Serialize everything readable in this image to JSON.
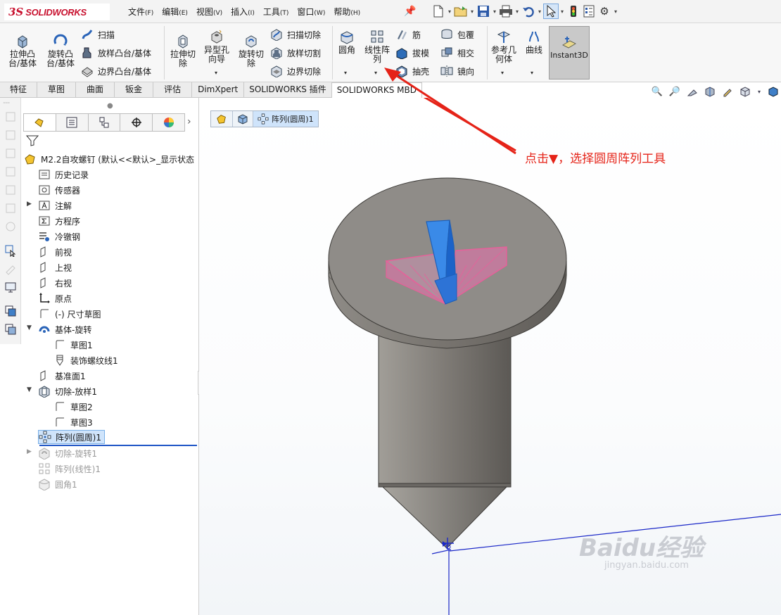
{
  "app": {
    "logo_ds": "3S",
    "logo_text": "SOLIDWORKS"
  },
  "menu": [
    {
      "label": "文件",
      "key": "(F)"
    },
    {
      "label": "编辑",
      "key": "(E)"
    },
    {
      "label": "视图",
      "key": "(V)"
    },
    {
      "label": "插入",
      "key": "(I)"
    },
    {
      "label": "工具",
      "key": "(T)"
    },
    {
      "label": "窗口",
      "key": "(W)"
    },
    {
      "label": "帮助",
      "key": "(H)"
    }
  ],
  "ribbon": {
    "extrude_boss": "拉伸凸\n台/基体",
    "revolve_boss": "旋转凸\n台/基体",
    "sweep": "扫描",
    "loft_boss": "放样凸台/基体",
    "boundary_boss": "边界凸台/基体",
    "extrude_cut": "拉伸切\n除",
    "hole_wizard": "异型孔\n向导",
    "revolve_cut": "旋转切\n除",
    "sweep_cut": "扫描切除",
    "loft_cut": "放样切割",
    "boundary_cut": "边界切除",
    "fillet": "圆角",
    "linear_pattern": "线性阵\n列",
    "rib": "筋",
    "draft": "拔模",
    "shell": "抽壳",
    "wrap": "包覆",
    "intersect": "相交",
    "mirror": "镜向",
    "ref_geometry": "参考几\n何体",
    "curves": "曲线",
    "instant3d": "Instant3D"
  },
  "tabs": [
    "特征",
    "草图",
    "曲面",
    "钣金",
    "评估",
    "DimXpert",
    "SOLIDWORKS 插件",
    "SOLIDWORKS MBD"
  ],
  "tree": {
    "root": "M2.2自攻螺钉  (默认<<默认>_显示状态",
    "history": "历史记录",
    "sensors": "传感器",
    "annotations": "注解",
    "equations": "方程序",
    "material": "冷镦钢",
    "front": "前视",
    "top": "上视",
    "right": "右视",
    "origin": "原点",
    "dim_sketch": "(-) 尺寸草图",
    "revolve": "基体-旋转",
    "sketch1": "草图1",
    "thread1": "装饰螺纹线1",
    "plane1": "基准面1",
    "cut_loft": "切除-放样1",
    "sketch2": "草图2",
    "sketch3": "草图3",
    "circ_pattern": "阵列(圆周)1",
    "cut_revolve": "切除-旋转1",
    "lin_pattern": "阵列(线性)1",
    "fillet1": "圆角1"
  },
  "viewport": {
    "breadcrumb_active": "阵列(圆周)1",
    "callout": "点击▼，选择圆周阵列工具",
    "watermark": "Baidu经验",
    "watermark_url": "jingyan.baidu.com"
  },
  "colors": {
    "accent_red": "#e52318",
    "selection_blue": "#1e7be0",
    "cut_pink": "#e8609a",
    "body_gray": "#8f8c88"
  }
}
